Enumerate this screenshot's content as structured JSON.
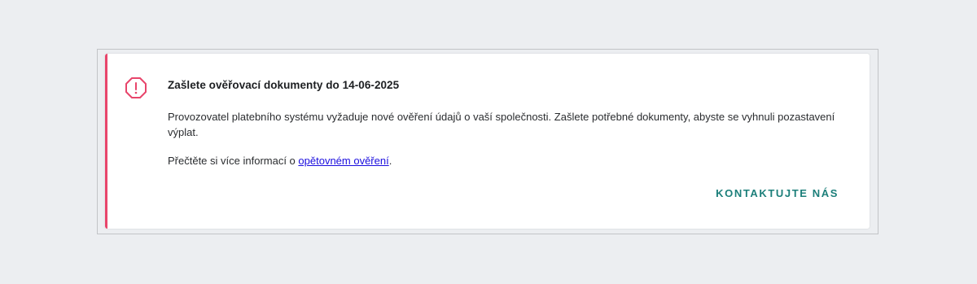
{
  "alert": {
    "title": "Zašlete ověřovací dokumenty do 14-06-2025",
    "body": "Provozovatel platebního systému vyžaduje nové ověření údajů o vaší společnosti. Zašlete potřebné dokumenty, abyste se vyhnuli pozastavení výplat.",
    "more_prefix": "Přečtěte si více informací o ",
    "more_link": "opětovném ověření",
    "more_suffix": ".",
    "action_label": "KONTAKTUJTE NÁS",
    "icon": "alert-octagon-icon"
  },
  "colors": {
    "accent": "#e8456b",
    "link": "#1a0dde",
    "action": "#1c7f7a"
  }
}
